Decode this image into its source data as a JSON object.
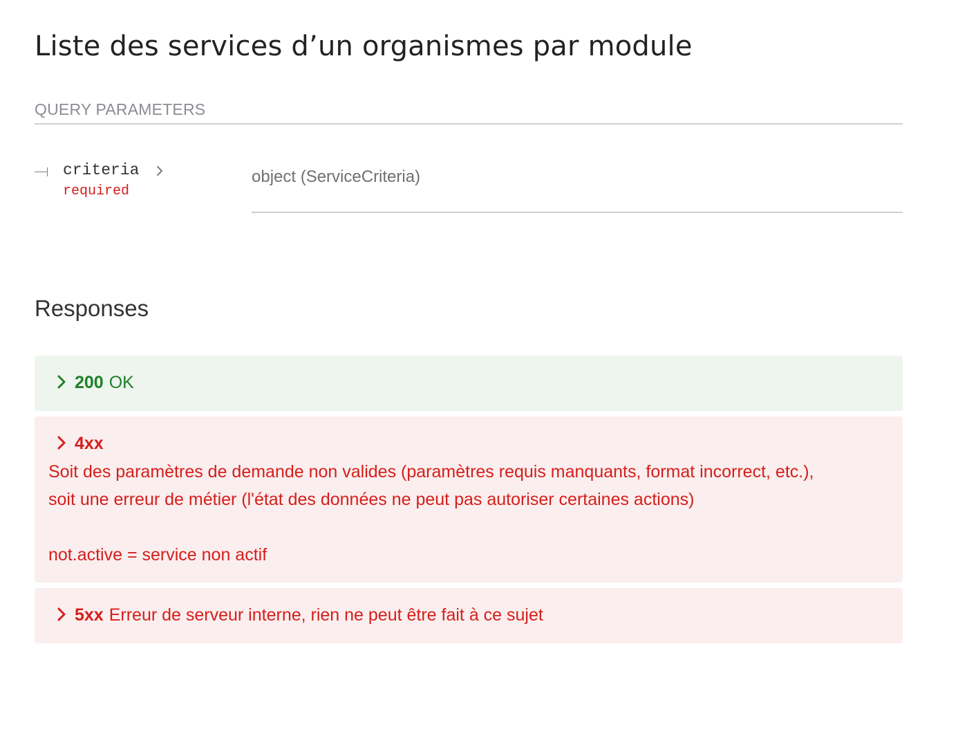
{
  "page": {
    "title": "Liste des services d’un organismes par module"
  },
  "query_parameters": {
    "header": "QUERY PARAMETERS",
    "params": [
      {
        "name": "criteria",
        "required_label": "required",
        "type": "object (ServiceCriteria)"
      }
    ]
  },
  "responses": {
    "title": "Responses",
    "items": [
      {
        "code": "200",
        "summary": "OK",
        "color": "#1d8127",
        "background": "#eef5ee"
      },
      {
        "code": "4xx",
        "summary": "",
        "description_lines": [
          "Soit des paramètres de demande non valides (paramètres requis manquants, format incorrect, etc.),",
          "soit une erreur de métier (l'état des données ne peut pas autoriser certaines actions)"
        ],
        "note": "not.active = service non actif",
        "color": "#d41f1c",
        "background": "#fbeeee"
      },
      {
        "code": "5xx",
        "summary": "Erreur de serveur interne, rien ne peut être fait à ce sujet",
        "color": "#d41f1c",
        "background": "#fbeeee"
      }
    ]
  },
  "icons": {
    "param_expand": "chevron-right-icon",
    "response_expand": "chevron-right-icon"
  }
}
